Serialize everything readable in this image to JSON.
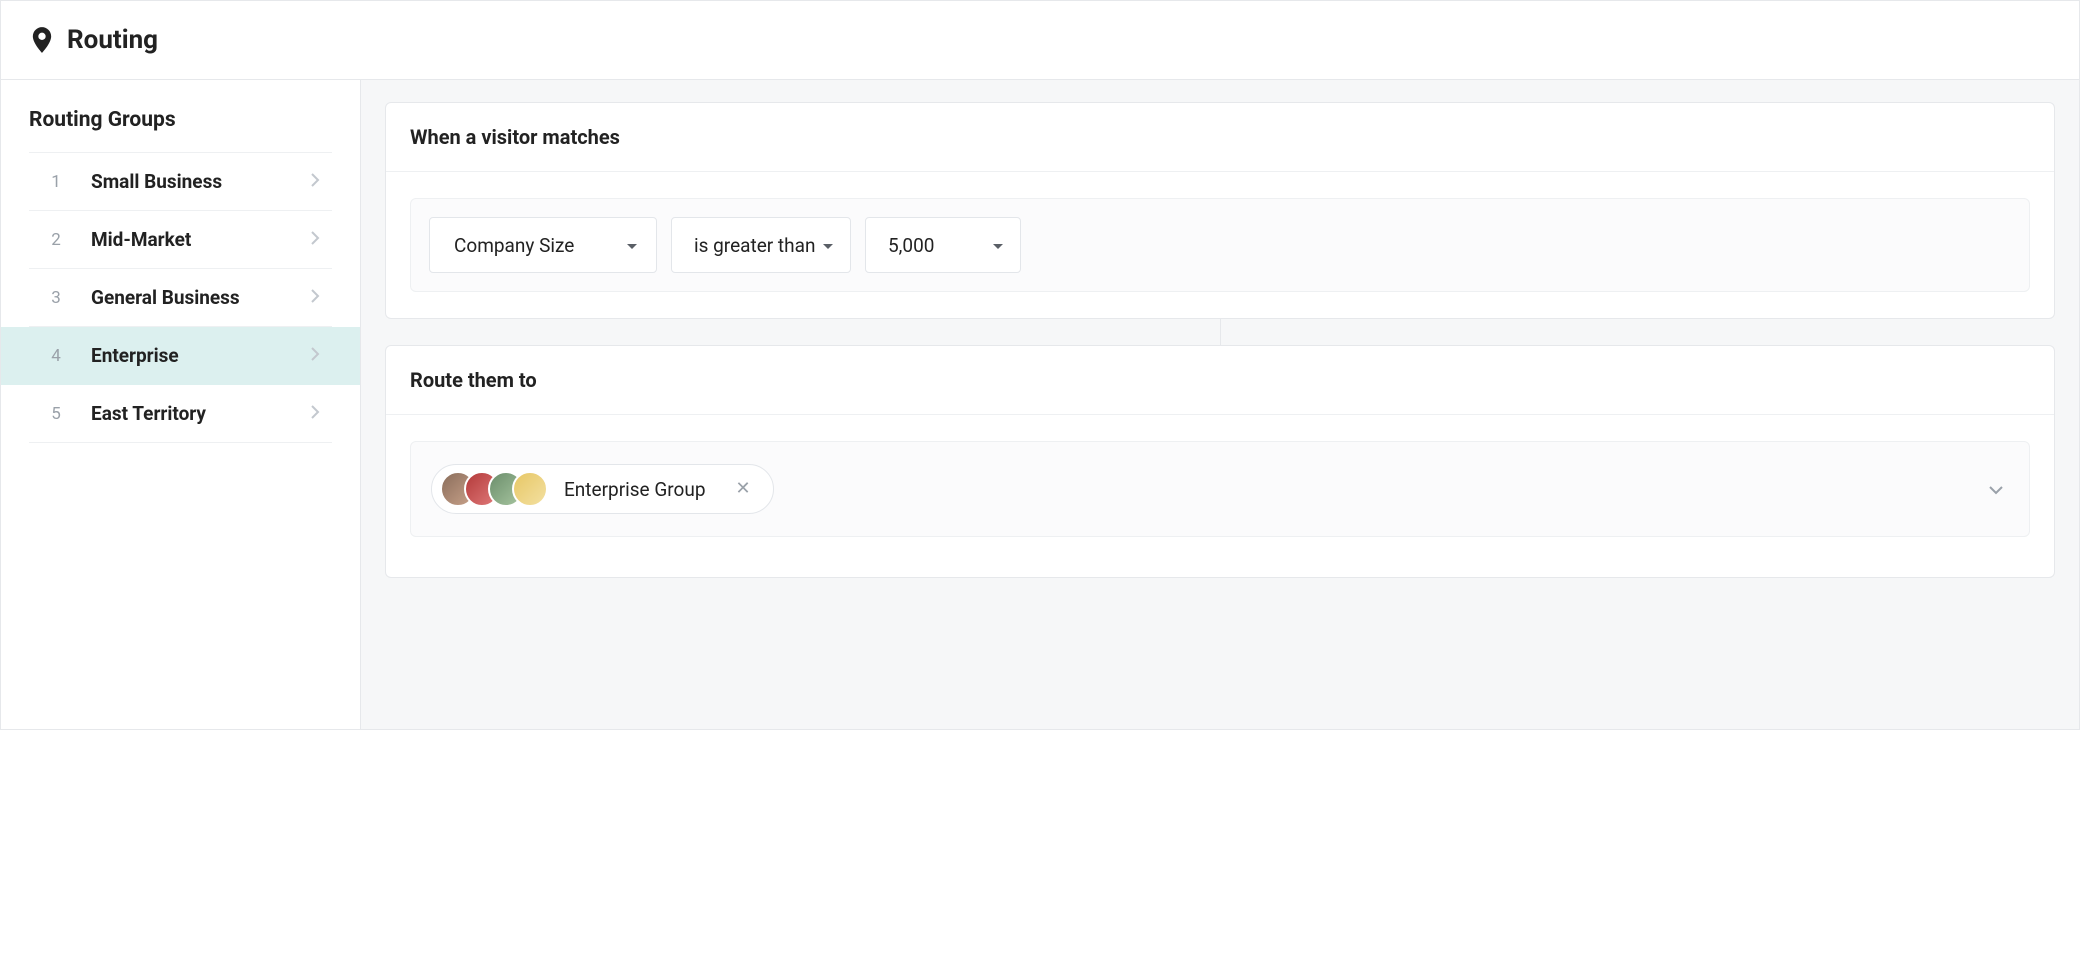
{
  "header": {
    "title": "Routing"
  },
  "sidebar": {
    "title": "Routing Groups",
    "items": [
      {
        "num": "1",
        "label": "Small Business"
      },
      {
        "num": "2",
        "label": "Mid-Market"
      },
      {
        "num": "3",
        "label": "General Business"
      },
      {
        "num": "4",
        "label": "Enterprise"
      },
      {
        "num": "5",
        "label": "East Territory"
      }
    ],
    "active_index": 3
  },
  "match_card": {
    "title": "When a visitor matches",
    "rule": {
      "field": "Company Size",
      "operator": "is greater than",
      "value": "5,000"
    }
  },
  "route_card": {
    "title": "Route them to",
    "selected_group": "Enterprise Group"
  }
}
